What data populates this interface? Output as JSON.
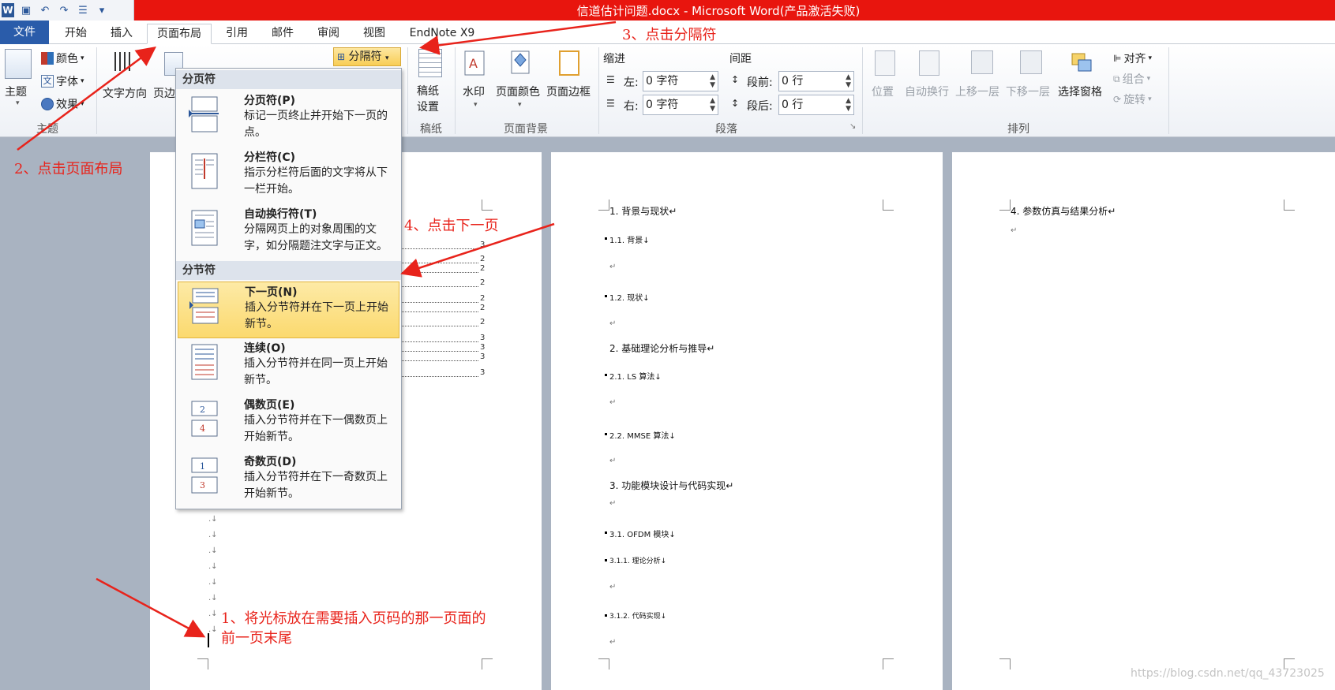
{
  "window": {
    "title": "信道估计问题.docx - Microsoft Word(产品激活失败)",
    "qat_icons": [
      "word-logo-icon",
      "save-icon",
      "undo-icon",
      "redo-icon",
      "list-icon",
      "customize-icon"
    ]
  },
  "tabs": [
    {
      "label": "文件"
    },
    {
      "label": "开始"
    },
    {
      "label": "插入"
    },
    {
      "label": "页面布局"
    },
    {
      "label": "引用"
    },
    {
      "label": "邮件"
    },
    {
      "label": "审阅"
    },
    {
      "label": "视图"
    },
    {
      "label": "EndNote X9"
    }
  ],
  "ribbon": {
    "theme_group": {
      "label": "主题",
      "theme_btn": "主题",
      "colors": "颜色",
      "fonts": "字体",
      "effects": "效果"
    },
    "page_setup": {
      "text_direction": "文字方向",
      "margins": "页边"
    },
    "breaks_btn": "分隔符",
    "manuscript": {
      "btn": "稿纸\n设置",
      "label": "稿纸"
    },
    "page_background": {
      "watermark": "水印",
      "page_color": "页面颜色",
      "page_borders": "页面边框",
      "label": "页面背景"
    },
    "paragraph": {
      "indent_label": "缩进",
      "spacing_label": "间距",
      "left_label": "左:",
      "left_value": "0 字符",
      "right_label": "右:",
      "right_value": "0 字符",
      "before_label": "段前:",
      "before_value": "0 行",
      "after_label": "段后:",
      "after_value": "0 行",
      "label": "段落"
    },
    "arrange": {
      "position": "位置",
      "wrap": "自动换行",
      "bring_forward": "上移一层",
      "send_backward": "下移一层",
      "selection_pane": "选择窗格",
      "align": "对齐",
      "group": "组合",
      "rotate": "旋转",
      "label": "排列"
    }
  },
  "dropdown": {
    "page_breaks_header": "分页符",
    "section_breaks_header": "分节符",
    "items": [
      {
        "title": "分页符(P)",
        "desc": "标记一页终止并开始下一页的点。"
      },
      {
        "title": "分栏符(C)",
        "desc": "指示分栏符后面的文字将从下一栏开始。"
      },
      {
        "title": "自动换行符(T)",
        "desc": "分隔网页上的对象周围的文字，如分隔题注文字与正文。"
      },
      {
        "title": "下一页(N)",
        "desc": "插入分节符并在下一页上开始新节。"
      },
      {
        "title": "连续(O)",
        "desc": "插入分节符并在同一页上开始新节。"
      },
      {
        "title": "偶数页(E)",
        "desc": "插入分节符并在下一偶数页上开始新节。"
      },
      {
        "title": "奇数页(D)",
        "desc": "插入分节符并在下一奇数页上开始新节。"
      }
    ]
  },
  "page1": {
    "toc_numbers": [
      "3",
      "2",
      "2",
      "2",
      "2",
      "2",
      "2",
      "3",
      "3",
      "3",
      "3"
    ]
  },
  "page2": {
    "lines": [
      "1. 背景与现状↵",
      "1.1. 背景↓",
      "↵",
      "1.2. 现状↓",
      "↵",
      "2. 基础理论分析与推导↵",
      "2.1. LS 算法↓",
      "↵",
      "2.2. MMSE 算法↓",
      "↵",
      "3. 功能模块设计与代码实现↵",
      "↵",
      "3.1. OFDM 模块↓",
      "3.1.1. 理论分析↓",
      "↵",
      "3.1.2. 代码实现↓",
      "↵"
    ]
  },
  "page3": {
    "lines": [
      "4. 参数仿真与结果分析↵",
      "↵"
    ]
  },
  "annotations": {
    "step1": "1、将光标放在需要插入页码的那一页面的",
    "step1b": "前一页末尾",
    "step2": "2、点击页面布局",
    "step3": "3、点击分隔符",
    "step4": "4、点击下一页"
  },
  "watermark": "https://blog.csdn.net/qq_43723025",
  "colors": {
    "title_bar": "#e8150e",
    "file_tab": "#2a5caa",
    "annotation": "#e8231b",
    "highlight": "#fbd96e"
  }
}
